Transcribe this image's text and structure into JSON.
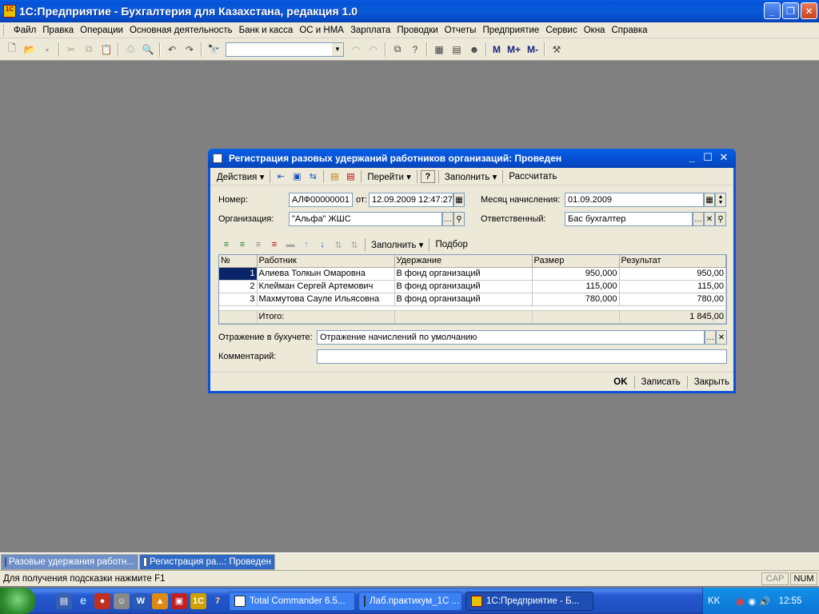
{
  "app": {
    "title": "1С:Предприятие - Бухгалтерия для Казахстана, редакция 1.0",
    "icon_text": "1С"
  },
  "menu": [
    "Файл",
    "Правка",
    "Операции",
    "Основная деятельность",
    "Банк и касса",
    "ОС и НМА",
    "Зарплата",
    "Проводки",
    "Отчеты",
    "Предприятие",
    "Сервис",
    "Окна",
    "Справка"
  ],
  "toolbar": {
    "search_value": "",
    "m_label": "M",
    "m_plus_label": "M+",
    "m_minus_label": "M-"
  },
  "doc": {
    "title": "Регистрация разовых удержаний работников организаций: Проведен",
    "bar": {
      "actions": "Действия",
      "goto": "Перейти",
      "help": "?",
      "fill": "Заполнить",
      "calc": "Рассчитать"
    },
    "form": {
      "number_label": "Номер:",
      "number_value": "АЛФ00000001",
      "date_label": "от:",
      "date_value": "12.09.2009 12:47:27",
      "month_label": "Месяц начисления:",
      "month_value": "01.09.2009",
      "org_label": "Организация:",
      "org_value": "\"Альфа\" ЖШС",
      "resp_label": "Ответственный:",
      "resp_value": "Бас бухгалтер"
    },
    "table_bar": {
      "fill": "Заполнить",
      "select": "Подбор"
    },
    "table": {
      "headers": [
        "№",
        "Работник",
        "Удержание",
        "Размер",
        "Результат"
      ],
      "rows": [
        {
          "n": "1",
          "worker": "Алиева Толкын Омаровна",
          "deduction": "В фонд организаций",
          "size": "950,000",
          "result": "950,00"
        },
        {
          "n": "2",
          "worker": "Клейман Сергей Артемович",
          "deduction": "В фонд организаций",
          "size": "115,000",
          "result": "115,00"
        },
        {
          "n": "3",
          "worker": "Махмутова Сауле Ильясовна",
          "deduction": "В фонд организаций",
          "size": "780,000",
          "result": "780,00"
        }
      ],
      "total_label": "Итого:",
      "total_result": "1 845,00"
    },
    "accounting_label": "Отражение в бухучете:",
    "accounting_value": "Отражение начислений по умолчанию",
    "comment_label": "Комментарий:",
    "comment_value": "",
    "buttons": {
      "ok": "OK",
      "save": "Записать",
      "close": "Закрыть"
    }
  },
  "window_tabs": [
    {
      "label": "Разовые удержания работн..."
    },
    {
      "label": "Регистрация ра...: Проведен"
    }
  ],
  "status": {
    "message": "Для получения подсказки нажмите F1",
    "cap": "CAP",
    "num": "NUM"
  },
  "taskbar": {
    "tasks": [
      {
        "label": "Total Commander 6.5..."
      },
      {
        "label": "Лаб.практикум_1С ..."
      },
      {
        "label": "1С:Предприятие - Б..."
      }
    ],
    "lang": "KK",
    "clock": "12:55"
  }
}
